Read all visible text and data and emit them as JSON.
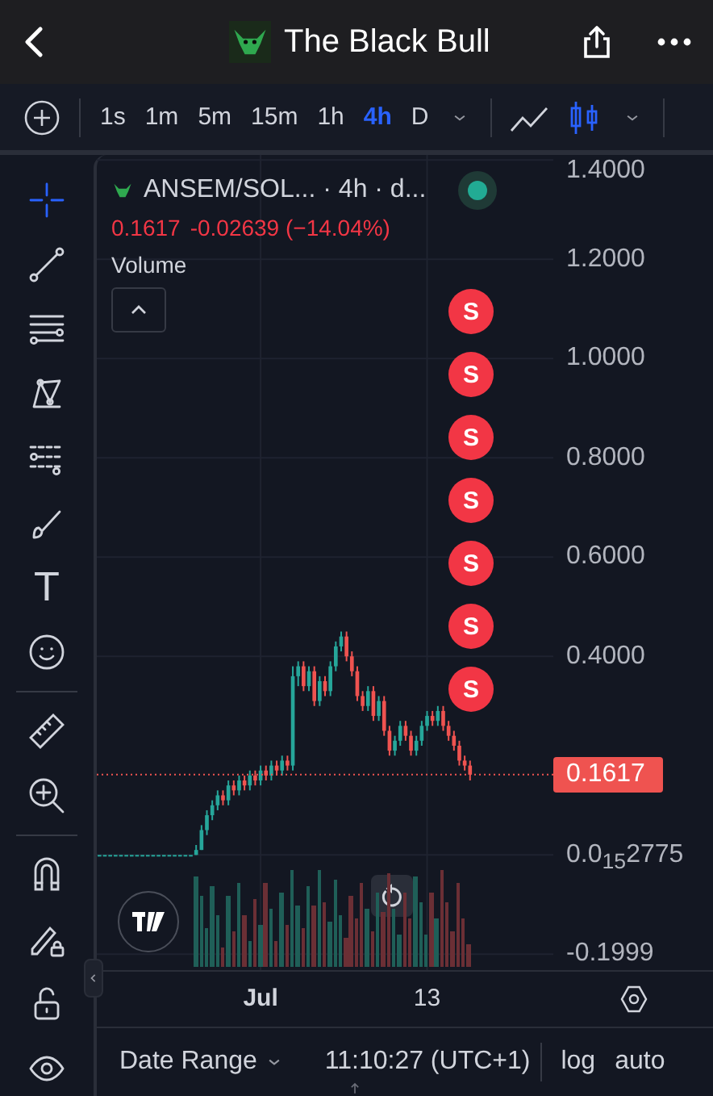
{
  "header": {
    "title": "The Black Bull"
  },
  "toolbar": {
    "intervals": [
      {
        "label": "1s",
        "selected": false
      },
      {
        "label": "1m",
        "selected": false
      },
      {
        "label": "5m",
        "selected": false
      },
      {
        "label": "15m",
        "selected": false
      },
      {
        "label": "1h",
        "selected": false
      },
      {
        "label": "4h",
        "selected": true
      },
      {
        "label": "D",
        "selected": false
      }
    ],
    "chart_types": [
      {
        "kind": "line",
        "selected": false
      },
      {
        "kind": "candles",
        "selected": true
      }
    ]
  },
  "tool_groups": [
    [
      {
        "kind": "crosshair",
        "selected": true
      },
      {
        "kind": "trendline",
        "selected": false
      },
      {
        "kind": "hlines",
        "selected": false
      },
      {
        "kind": "pattern",
        "selected": false
      },
      {
        "kind": "fib",
        "selected": false
      },
      {
        "kind": "brush",
        "selected": false
      },
      {
        "kind": "text",
        "glyph": "T",
        "selected": false
      },
      {
        "kind": "emoji",
        "selected": false
      }
    ],
    [
      {
        "kind": "ruler",
        "selected": false
      },
      {
        "kind": "zoom",
        "selected": false
      }
    ],
    [
      {
        "kind": "magnet",
        "selected": false
      },
      {
        "kind": "lockdraw",
        "selected": false
      },
      {
        "kind": "lock",
        "selected": false
      },
      {
        "kind": "eye",
        "selected": false
      }
    ]
  ],
  "legend": {
    "symbol": "ANSEM/SOL... · 4h · d...",
    "price": "0.1617",
    "change": "-0.02639 (−14.04%)",
    "indicator": "Volume"
  },
  "markers": [
    {
      "text": "S"
    },
    {
      "text": "S"
    },
    {
      "text": "S"
    },
    {
      "text": "S"
    },
    {
      "text": "S"
    },
    {
      "text": "S"
    },
    {
      "text": "S"
    }
  ],
  "chart": {
    "chart_data": {
      "type": "candlestick",
      "ylim": [
        -0.232,
        1.41
      ],
      "grid": true,
      "ref_lines": [
        {
          "axis": "y",
          "value": 0.1617,
          "label": "0.1617",
          "color": "#ef5350"
        }
      ],
      "yticks": [
        {
          "value": 1.4,
          "label": "1.4000"
        },
        {
          "value": 1.2,
          "label": "1.2000"
        },
        {
          "value": 1.0,
          "label": "1.0000"
        },
        {
          "value": 0.8,
          "label": "0.8000"
        },
        {
          "value": 0.6,
          "label": "0.6000"
        },
        {
          "value": 0.4,
          "label": "0.4000"
        },
        {
          "value": 2.775e-16,
          "label": "0.0$_{15}$2775"
        },
        {
          "value": -0.1999,
          "label": "-0.1999"
        }
      ],
      "categories": [
        null,
        null,
        null,
        null,
        null,
        null,
        null,
        null,
        null,
        null,
        null,
        null,
        null,
        null,
        null,
        null,
        null,
        null,
        null,
        null,
        null,
        null,
        null,
        null,
        null,
        null,
        null,
        null,
        null,
        null,
        "Jul",
        null,
        null,
        null,
        null,
        null,
        null,
        null,
        null,
        null,
        null,
        null,
        null,
        null,
        null,
        null,
        null,
        null,
        null,
        null,
        null,
        null,
        null,
        null,
        null,
        null,
        null,
        null,
        null,
        null,
        null,
        "13",
        null,
        null,
        null,
        null,
        null,
        null,
        null,
        null
      ],
      "ohlc": [
        [
          0,
          0,
          0,
          0
        ],
        [
          0,
          0,
          0,
          0
        ],
        [
          0,
          0,
          0,
          0
        ],
        [
          0,
          0,
          0,
          0
        ],
        [
          0,
          0,
          0,
          0
        ],
        [
          0,
          0,
          0,
          0
        ],
        [
          0,
          0,
          0,
          0
        ],
        [
          0,
          0,
          0,
          0
        ],
        [
          0,
          0,
          0,
          0
        ],
        [
          0,
          0,
          0,
          0
        ],
        [
          0,
          0,
          0,
          0
        ],
        [
          0,
          0,
          0,
          0
        ],
        [
          0,
          0,
          0,
          0
        ],
        [
          0,
          0,
          0,
          0
        ],
        [
          0,
          0,
          0,
          0
        ],
        [
          0,
          0,
          0,
          0
        ],
        [
          0,
          0,
          0,
          0
        ],
        [
          0,
          0,
          0,
          0
        ],
        [
          0,
          0.02,
          0,
          0.01
        ],
        [
          0.01,
          0.06,
          0.01,
          0.05
        ],
        [
          0.05,
          0.09,
          0.04,
          0.08
        ],
        [
          0.08,
          0.11,
          0.07,
          0.1
        ],
        [
          0.1,
          0.13,
          0.09,
          0.12
        ],
        [
          0.12,
          0.13,
          0.1,
          0.11
        ],
        [
          0.11,
          0.15,
          0.1,
          0.14
        ],
        [
          0.14,
          0.15,
          0.12,
          0.13
        ],
        [
          0.13,
          0.16,
          0.12,
          0.15
        ],
        [
          0.15,
          0.16,
          0.13,
          0.14
        ],
        [
          0.14,
          0.17,
          0.13,
          0.16
        ],
        [
          0.16,
          0.17,
          0.14,
          0.15
        ],
        [
          0.15,
          0.18,
          0.14,
          0.17
        ],
        [
          0.17,
          0.18,
          0.15,
          0.16
        ],
        [
          0.16,
          0.19,
          0.15,
          0.18
        ],
        [
          0.18,
          0.19,
          0.16,
          0.17
        ],
        [
          0.17,
          0.2,
          0.16,
          0.19
        ],
        [
          0.19,
          0.2,
          0.17,
          0.18
        ],
        [
          0.18,
          0.38,
          0.17,
          0.36
        ],
        [
          0.36,
          0.39,
          0.34,
          0.38
        ],
        [
          0.38,
          0.39,
          0.33,
          0.34
        ],
        [
          0.34,
          0.38,
          0.33,
          0.37
        ],
        [
          0.37,
          0.38,
          0.3,
          0.31
        ],
        [
          0.31,
          0.36,
          0.3,
          0.35
        ],
        [
          0.35,
          0.36,
          0.32,
          0.33
        ],
        [
          0.33,
          0.39,
          0.32,
          0.38
        ],
        [
          0.38,
          0.43,
          0.37,
          0.42
        ],
        [
          0.42,
          0.45,
          0.41,
          0.44
        ],
        [
          0.44,
          0.45,
          0.39,
          0.4
        ],
        [
          0.4,
          0.41,
          0.36,
          0.37
        ],
        [
          0.37,
          0.38,
          0.31,
          0.32
        ],
        [
          0.32,
          0.33,
          0.29,
          0.3
        ],
        [
          0.3,
          0.34,
          0.29,
          0.33
        ],
        [
          0.33,
          0.34,
          0.27,
          0.28
        ],
        [
          0.28,
          0.32,
          0.27,
          0.31
        ],
        [
          0.31,
          0.32,
          0.24,
          0.25
        ],
        [
          0.25,
          0.26,
          0.2,
          0.21
        ],
        [
          0.21,
          0.24,
          0.2,
          0.23
        ],
        [
          0.23,
          0.27,
          0.22,
          0.26
        ],
        [
          0.26,
          0.27,
          0.23,
          0.24
        ],
        [
          0.24,
          0.25,
          0.2,
          0.21
        ],
        [
          0.21,
          0.24,
          0.2,
          0.23
        ],
        [
          0.23,
          0.27,
          0.22,
          0.26
        ],
        [
          0.26,
          0.29,
          0.25,
          0.28
        ],
        [
          0.28,
          0.29,
          0.26,
          0.27
        ],
        [
          0.27,
          0.3,
          0.26,
          0.29
        ],
        [
          0.29,
          0.3,
          0.25,
          0.26
        ],
        [
          0.26,
          0.27,
          0.23,
          0.24
        ],
        [
          0.24,
          0.25,
          0.21,
          0.22
        ],
        [
          0.22,
          0.23,
          0.18,
          0.19
        ],
        [
          0.19,
          0.2,
          0.17,
          0.18
        ],
        [
          0.18,
          0.19,
          0.15,
          0.1617
        ]
      ]
    }
  },
  "status_bar": {
    "date_range": "Date Range",
    "time": "11:10:27 (UTC+1)",
    "scale_options": [
      {
        "label": "log",
        "selected": false
      },
      {
        "label": "auto",
        "selected": false
      }
    ]
  }
}
